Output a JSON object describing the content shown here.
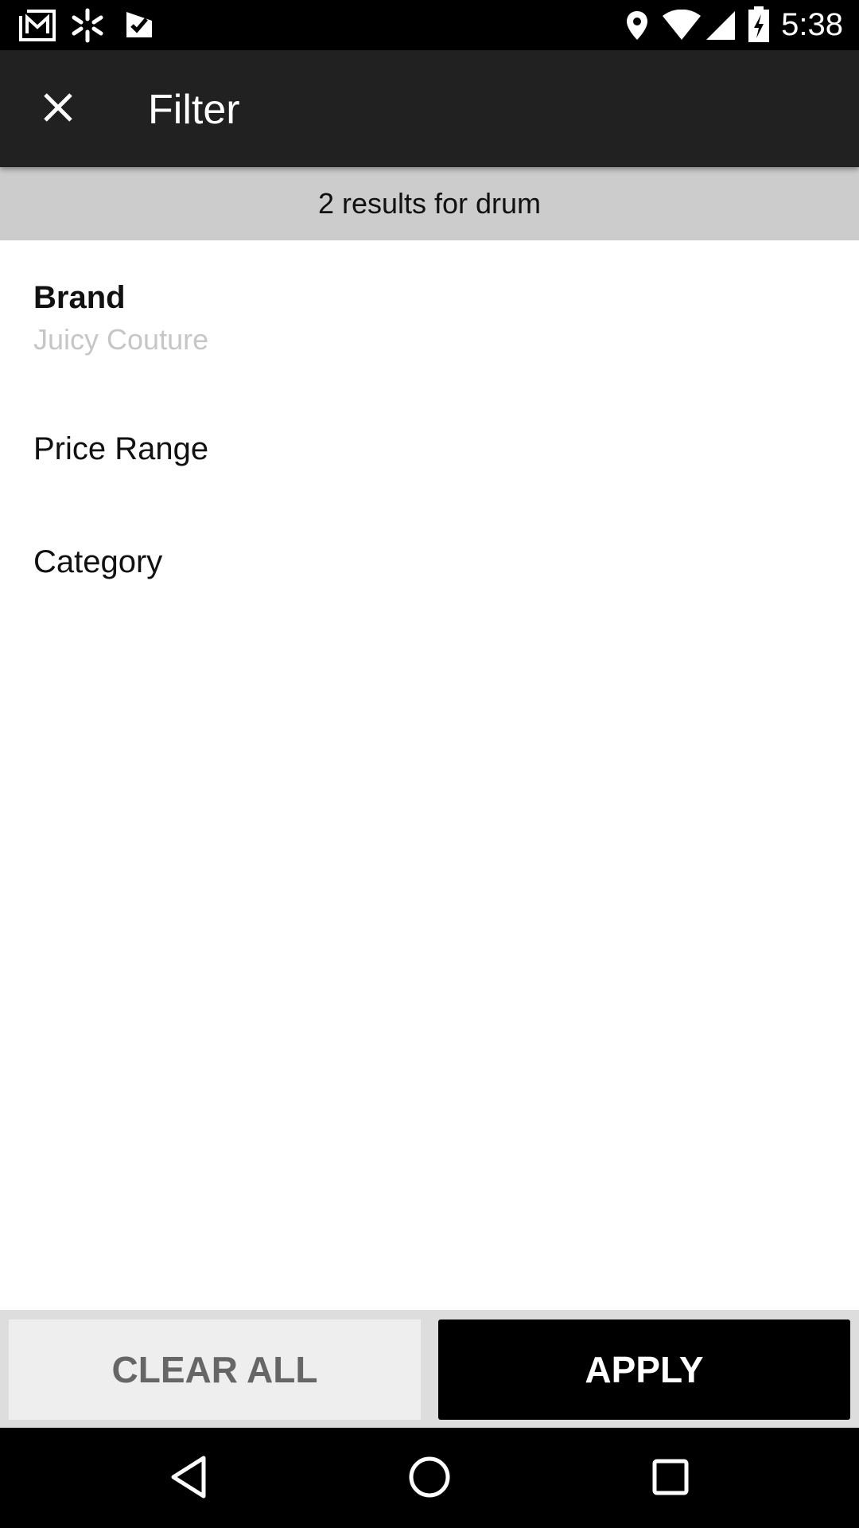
{
  "status_bar": {
    "time": "5:38",
    "left_icons": [
      "gmail-icon",
      "walmart-spark-icon",
      "checkmark-app-icon"
    ],
    "right_icons": [
      "location-icon",
      "wifi-icon",
      "signal-icon",
      "battery-charging-icon"
    ]
  },
  "app_bar": {
    "title": "Filter",
    "close_icon": "close-icon",
    "background": "#212121"
  },
  "results_banner": {
    "text": "2 results for drum"
  },
  "filters": {
    "brand": {
      "label": "Brand",
      "value": "Juicy Couture"
    },
    "price_range": {
      "label": "Price Range"
    },
    "category": {
      "label": "Category"
    }
  },
  "actions": {
    "clear_all": "CLEAR ALL",
    "apply": "APPLY"
  },
  "nav_bar": {
    "icons": [
      "back-icon",
      "home-icon",
      "recents-icon"
    ]
  }
}
